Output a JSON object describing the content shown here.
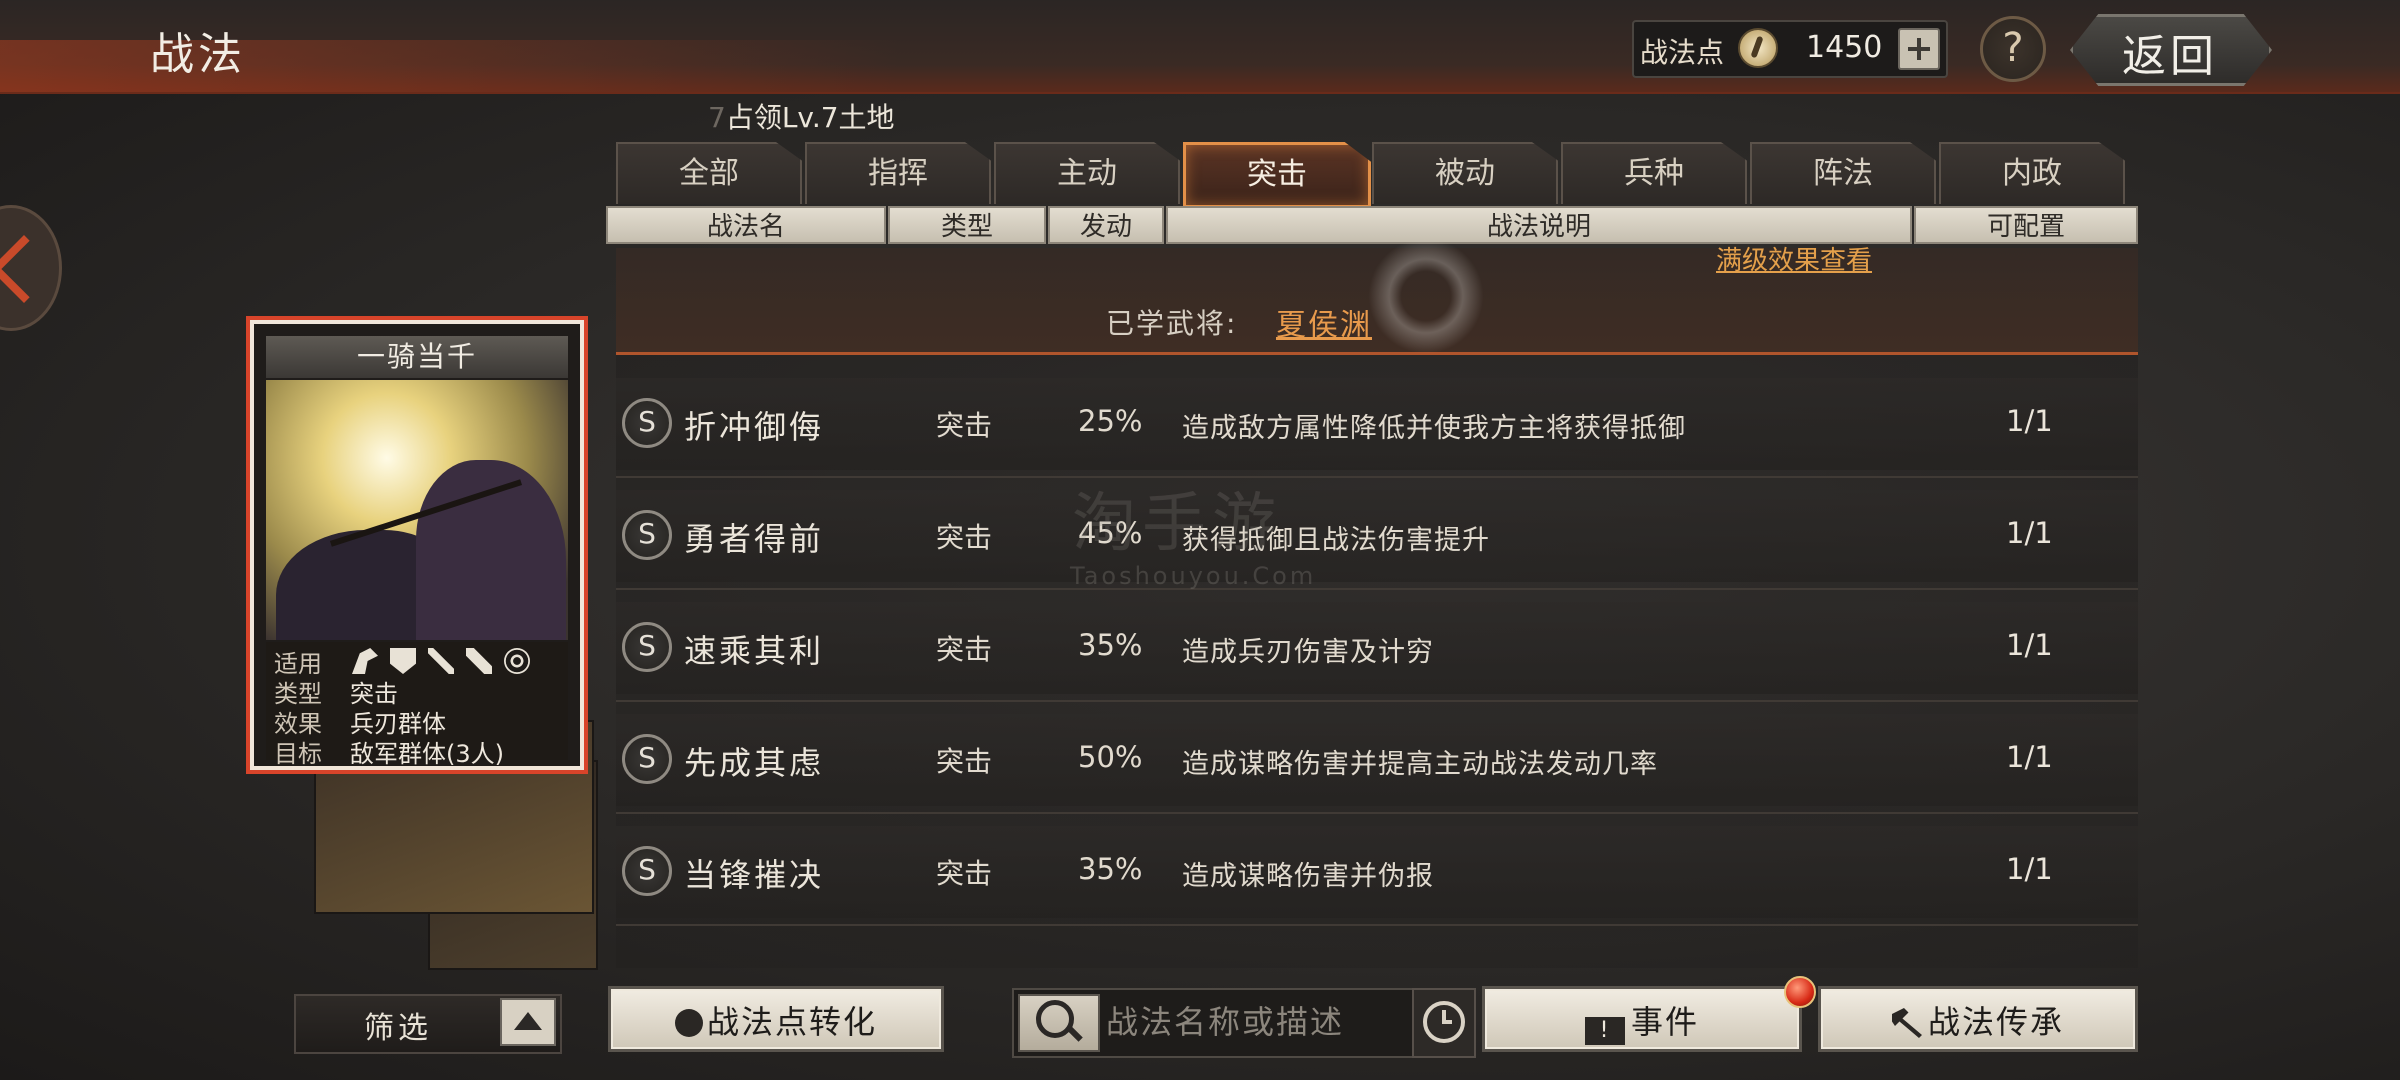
{
  "header": {
    "title": "战法",
    "points_label": "战法点",
    "points_value": "1450",
    "help_label": "?",
    "back_label": "返回"
  },
  "hint": {
    "faded_prefix": "7",
    "text": "占领Lv.7土地"
  },
  "tabs": [
    {
      "label": "全部",
      "active": false
    },
    {
      "label": "指挥",
      "active": false
    },
    {
      "label": "主动",
      "active": false
    },
    {
      "label": "突击",
      "active": true
    },
    {
      "label": "被动",
      "active": false
    },
    {
      "label": "兵种",
      "active": false
    },
    {
      "label": "阵法",
      "active": false
    },
    {
      "label": "内政",
      "active": false
    }
  ],
  "columns": {
    "name": "战法名",
    "type": "类型",
    "rate": "发动",
    "desc": "战法说明",
    "config": "可配置"
  },
  "expanded": {
    "full_level_link": "满级效果查看",
    "learned_label": "已学武将:",
    "learned_name": "夏侯渊"
  },
  "rows": [
    {
      "grade": "S",
      "name": "折冲御侮",
      "type": "突击",
      "rate": "25%",
      "desc": "造成敌方属性降低并使我方主将获得抵御",
      "config": "1/1"
    },
    {
      "grade": "S",
      "name": "勇者得前",
      "type": "突击",
      "rate": "45%",
      "desc": "获得抵御且战法伤害提升",
      "config": "1/1"
    },
    {
      "grade": "S",
      "name": "速乘其利",
      "type": "突击",
      "rate": "35%",
      "desc": "造成兵刃伤害及计穷",
      "config": "1/1"
    },
    {
      "grade": "S",
      "name": "先成其虑",
      "type": "突击",
      "rate": "50%",
      "desc": "造成谋略伤害并提高主动战法发动几率",
      "config": "1/1"
    },
    {
      "grade": "S",
      "name": "当锋摧决",
      "type": "突击",
      "rate": "35%",
      "desc": "造成谋略伤害并伪报",
      "config": "1/1"
    }
  ],
  "watermark": {
    "text": "淘手游",
    "sub": "Taoshouyou.Com"
  },
  "card": {
    "title": "一骑当千",
    "apply_key": "适用",
    "type_key": "类型",
    "type_val": "突击",
    "effect_key": "效果",
    "effect_val": "兵刃群体",
    "target_key": "目标",
    "target_val": "敌军群体(3人)",
    "unit_icons": [
      "horse-icon",
      "shield-icon",
      "bow-icon",
      "spear-icon",
      "wheel-icon"
    ]
  },
  "bottom": {
    "filter_label": "筛选",
    "convert_label": "战法点转化",
    "search_placeholder": "战法名称或描述",
    "event_label": "事件",
    "inherit_label": "战法传承"
  },
  "colors": {
    "accent": "#e39048",
    "link": "#e89a4c",
    "card_border": "#d8442a"
  }
}
